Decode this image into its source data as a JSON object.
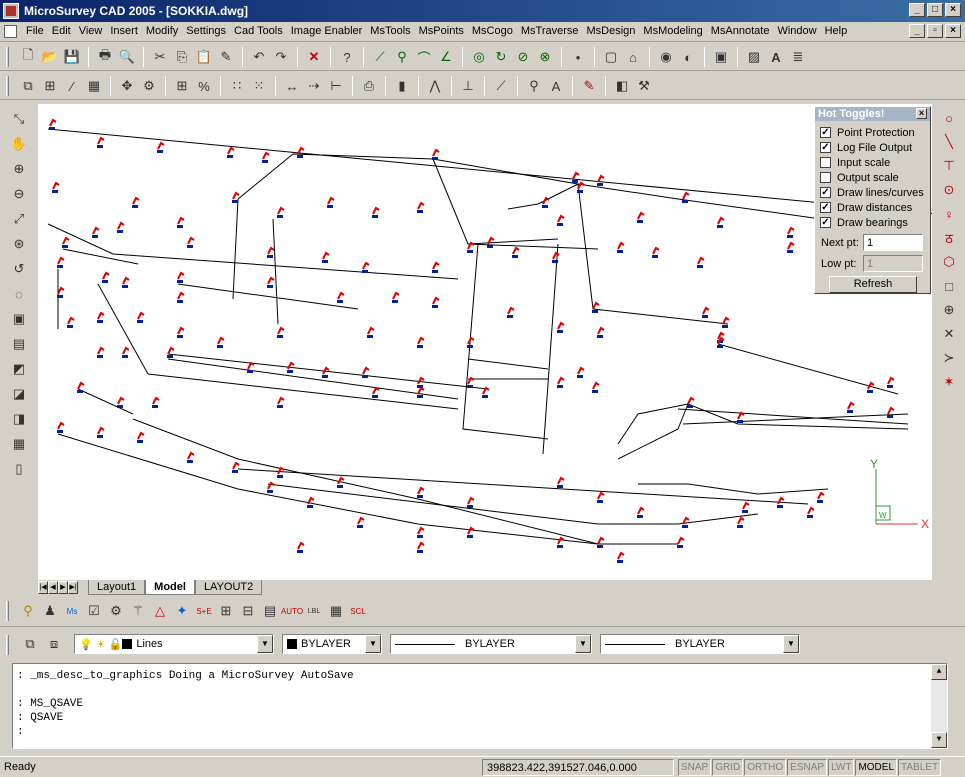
{
  "window": {
    "title": "MicroSurvey CAD 2005 - [SOKKIA.dwg]"
  },
  "menu": [
    "File",
    "Edit",
    "View",
    "Insert",
    "Modify",
    "Settings",
    "Cad Tools",
    "Image Enabler",
    "MsTools",
    "MsPoints",
    "MsCogo",
    "MsTraverse",
    "MsDesign",
    "MsModeling",
    "MsAnnotate",
    "Window",
    "Help"
  ],
  "hot_toggles": {
    "title": "Hot Toggles!",
    "items": [
      {
        "label": "Point Protection",
        "checked": true
      },
      {
        "label": "Log File Output",
        "checked": true
      },
      {
        "label": "Input scale",
        "checked": false
      },
      {
        "label": "Output scale",
        "checked": false
      },
      {
        "label": "Draw lines/curves",
        "checked": true
      },
      {
        "label": "Draw distances",
        "checked": true
      },
      {
        "label": "Draw bearings",
        "checked": true
      }
    ],
    "next_pt_label": "Next pt:",
    "next_pt_value": "1",
    "low_pt_label": "Low pt:",
    "low_pt_value": "1",
    "refresh_label": "Refresh"
  },
  "tabs": [
    "Layout1",
    "Model",
    "LAYOUT2"
  ],
  "active_tab": "Model",
  "layer_bar": {
    "layer": "Lines",
    "color": "BYLAYER",
    "linetype": "BYLAYER",
    "lineweight": "BYLAYER"
  },
  "ucs": {
    "x": "X",
    "y": "Y",
    "w": "W"
  },
  "command_lines": [
    ": _ms_desc_to_graphics Doing a MicroSurvey AutoSave",
    "",
    ": MS_QSAVE",
    ": QSAVE",
    ":"
  ],
  "status": {
    "ready": "Ready",
    "coords": "398823.422,391527.046,0.000",
    "toggles": [
      {
        "label": "SNAP",
        "on": false
      },
      {
        "label": "GRID",
        "on": false
      },
      {
        "label": "ORTHO",
        "on": false
      },
      {
        "label": "ESNAP",
        "on": false
      },
      {
        "label": "LWT",
        "on": false
      },
      {
        "label": "MODEL",
        "on": true
      },
      {
        "label": "TABLET",
        "on": false
      }
    ]
  }
}
